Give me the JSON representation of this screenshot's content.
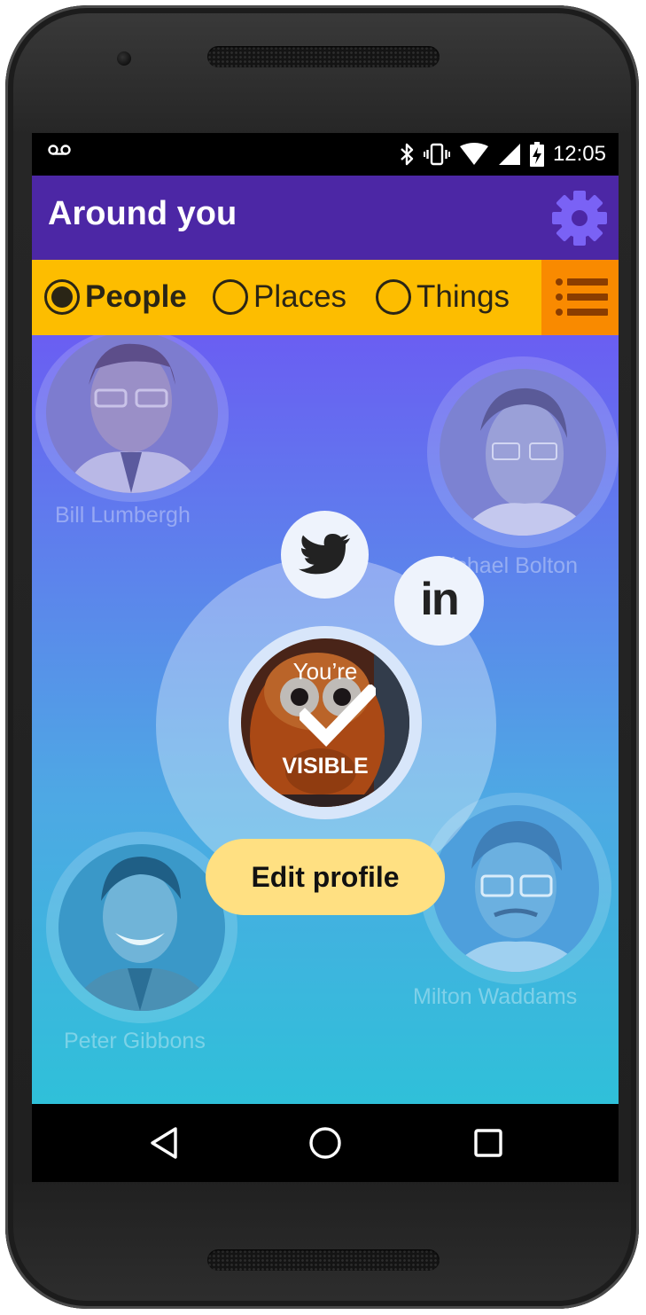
{
  "status_bar": {
    "time": "12:05",
    "icons": [
      "voicemail-icon",
      "bluetooth-icon",
      "vibrate-icon",
      "wifi-icon",
      "cell-signal-icon",
      "battery-charging-icon"
    ]
  },
  "app_bar": {
    "title": "Around you",
    "settings_icon": "gear-icon"
  },
  "filter": {
    "options": [
      {
        "label": "People",
        "selected": true
      },
      {
        "label": "Places",
        "selected": false
      },
      {
        "label": "Things",
        "selected": false
      }
    ],
    "list_icon": "list-icon"
  },
  "people": [
    {
      "name": "Bill Lumbergh"
    },
    {
      "name": "Michael Bolton"
    },
    {
      "name": "Milton Waddams"
    },
    {
      "name": "Peter Gibbons"
    }
  ],
  "me": {
    "status_top": "You’re",
    "status_bottom": "VISIBLE",
    "social": [
      "twitter-icon",
      "linkedin-icon"
    ],
    "linkedin_text": "in",
    "edit_label": "Edit profile"
  },
  "nav_bar": {
    "buttons": [
      "back-icon",
      "home-icon",
      "recents-icon"
    ]
  },
  "colors": {
    "app_bar": "#4c27a5",
    "filter_bar": "#fdbd00",
    "list_button": "#f98a00",
    "gear": "#7a62f5",
    "edit_button": "#ffe082",
    "gradient_top": "#6a5ef2",
    "gradient_bottom": "#2fc0d9"
  }
}
